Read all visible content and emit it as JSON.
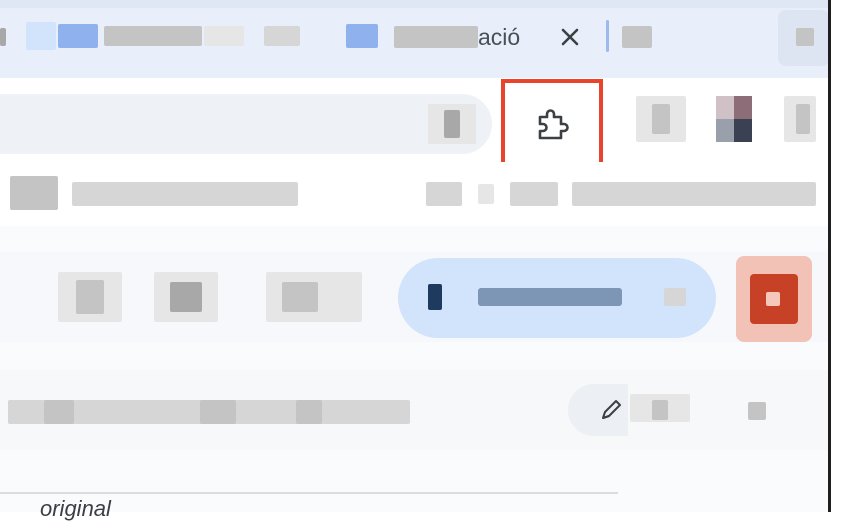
{
  "browser": {
    "active_tab": {
      "title_fragment": "ació",
      "close_icon": "close-icon"
    },
    "toolbar": {
      "extensions_icon": "puzzle-piece-icon",
      "highlight_color": "#e8432d"
    }
  },
  "page": {
    "edit_icon": "pencil-icon",
    "footer_text": "original"
  },
  "colors": {
    "tab_strip": "#dfe7f5",
    "selected_chip": "#d2e3fc",
    "user_avatar": "#c74127"
  }
}
